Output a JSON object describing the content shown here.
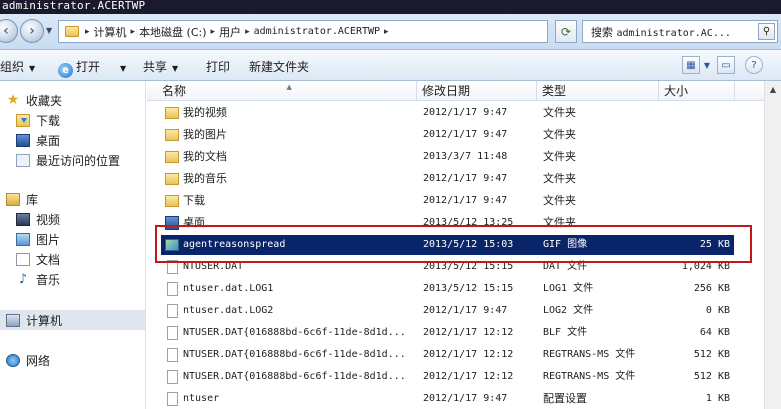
{
  "window": {
    "title": "administrator.ACERTWP"
  },
  "address": {
    "crumbs": [
      "计算机",
      "本地磁盘 (C:)",
      "用户",
      "administrator.ACERTWP"
    ],
    "search_placeholder_prefix": "搜索 ",
    "search_placeholder_path": "administrator.AC..."
  },
  "toolbar": {
    "organize": "组织",
    "open": "打开",
    "share": "共享",
    "print": "打印",
    "new_folder": "新建文件夹"
  },
  "nav": {
    "favorites": "收藏夹",
    "downloads": "下载",
    "desktop": "桌面",
    "recent": "最近访问的位置",
    "libraries": "库",
    "videos": "视频",
    "pictures": "图片",
    "documents": "文档",
    "music": "音乐",
    "computer": "计算机",
    "network": "网络"
  },
  "columns": {
    "name": "名称",
    "date": "修改日期",
    "type": "类型",
    "size": "大小"
  },
  "files": [
    {
      "name": "我的视频",
      "date": "2012/1/17 9:47",
      "type": "文件夹",
      "size": "",
      "icon": "folder-icon"
    },
    {
      "name": "我的图片",
      "date": "2012/1/17 9:47",
      "type": "文件夹",
      "size": "",
      "icon": "folder-icon"
    },
    {
      "name": "我的文档",
      "date": "2013/3/7 11:48",
      "type": "文件夹",
      "size": "",
      "icon": "folder-icon"
    },
    {
      "name": "我的音乐",
      "date": "2012/1/17 9:47",
      "type": "文件夹",
      "size": "",
      "icon": "folder-icon"
    },
    {
      "name": "下载",
      "date": "2012/1/17 9:47",
      "type": "文件夹",
      "size": "",
      "icon": "download-folder-icon"
    },
    {
      "name": "桌面",
      "date": "2013/5/12 13:25",
      "type": "文件夹",
      "size": "",
      "icon": "desktop-folder-icon"
    },
    {
      "name": "agentreasonspread",
      "date": "2013/5/12 15:03",
      "type": "GIF 图像",
      "size": "25 KB",
      "icon": "gif-image-icon",
      "selected": true
    },
    {
      "name": "NTUSER.DAT",
      "date": "2013/5/12 15:15",
      "type": "DAT 文件",
      "size": "1,024 KB",
      "icon": "file-icon"
    },
    {
      "name": "ntuser.dat.LOG1",
      "date": "2013/5/12 15:15",
      "type": "LOG1 文件",
      "size": "256 KB",
      "icon": "file-icon"
    },
    {
      "name": "ntuser.dat.LOG2",
      "date": "2012/1/17 9:47",
      "type": "LOG2 文件",
      "size": "0 KB",
      "icon": "file-icon"
    },
    {
      "name": "NTUSER.DAT{016888bd-6c6f-11de-8d1d...",
      "date": "2012/1/17 12:12",
      "type": "BLF 文件",
      "size": "64 KB",
      "icon": "file-icon"
    },
    {
      "name": "NTUSER.DAT{016888bd-6c6f-11de-8d1d...",
      "date": "2012/1/17 12:12",
      "type": "REGTRANS-MS 文件",
      "size": "512 KB",
      "icon": "file-icon"
    },
    {
      "name": "NTUSER.DAT{016888bd-6c6f-11de-8d1d...",
      "date": "2012/1/17 12:12",
      "type": "REGTRANS-MS 文件",
      "size": "512 KB",
      "icon": "file-icon"
    },
    {
      "name": "ntuser",
      "date": "2012/1/17 9:47",
      "type": "配置设置",
      "size": "1 KB",
      "icon": "settings-file-icon"
    }
  ]
}
